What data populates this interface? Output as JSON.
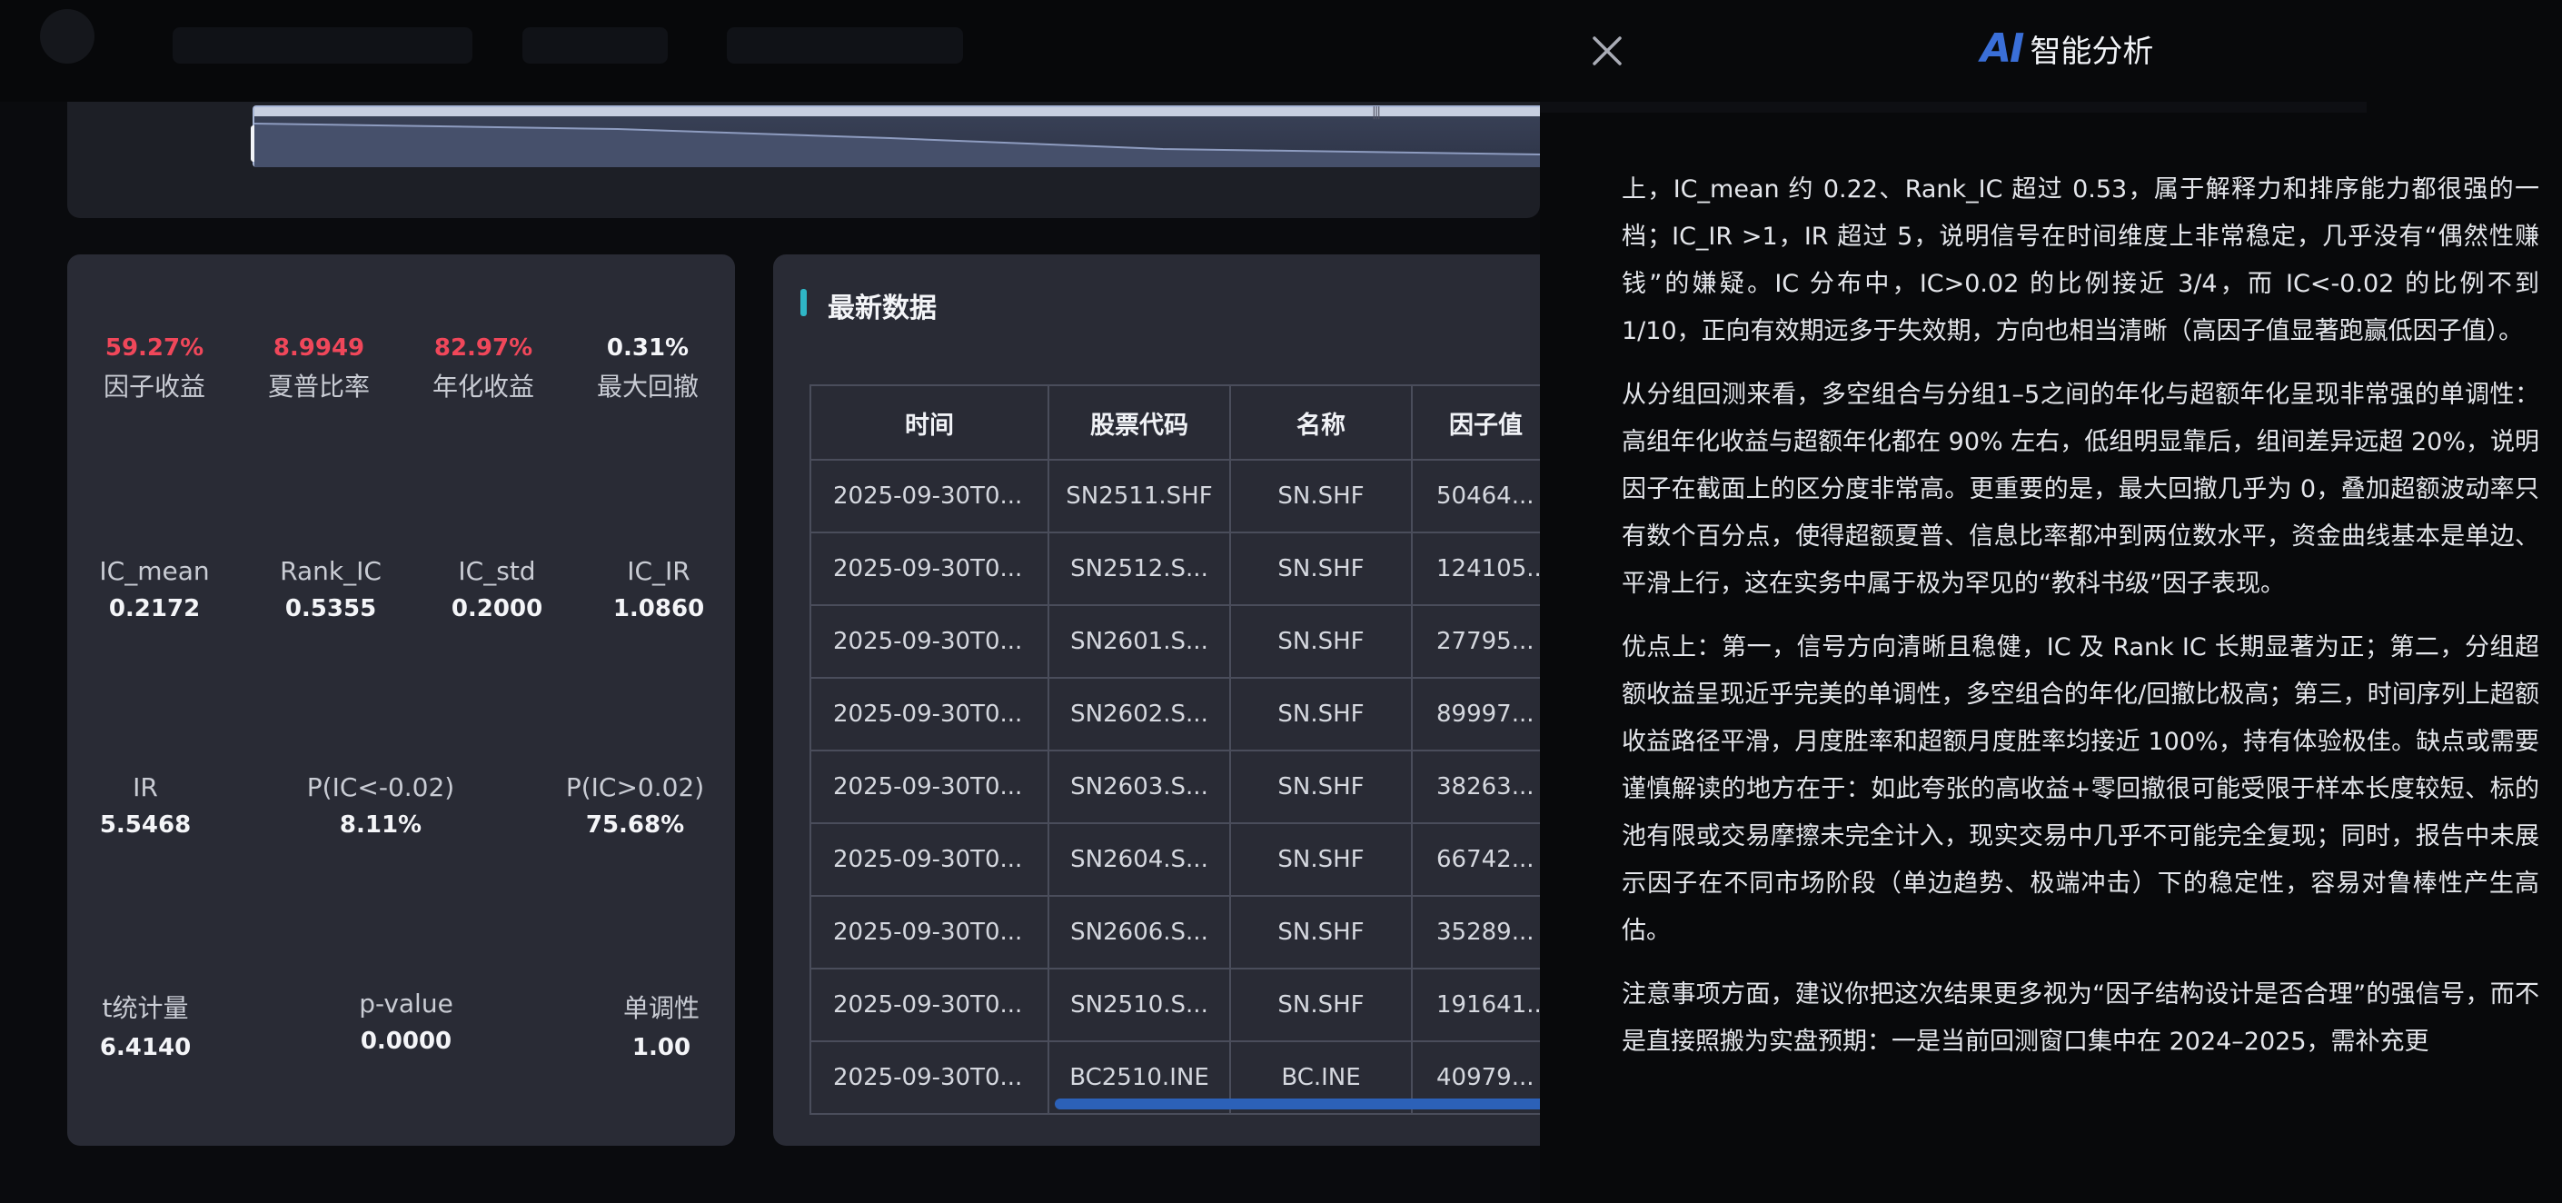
{
  "metrics": {
    "row1": [
      {
        "value": "59.27%",
        "label": "因子收益",
        "accent": "red"
      },
      {
        "value": "8.9949",
        "label": "夏普比率",
        "accent": "red"
      },
      {
        "value": "82.97%",
        "label": "年化收益",
        "accent": "red"
      },
      {
        "value": "0.31%",
        "label": "最大回撤",
        "accent": "none"
      }
    ],
    "row2": [
      {
        "label": "IC_mean",
        "value": "0.2172"
      },
      {
        "label": "Rank_IC",
        "value": "0.5355"
      },
      {
        "label": "IC_std",
        "value": "0.2000"
      },
      {
        "label": "IC_IR",
        "value": "1.0860"
      }
    ],
    "row3": [
      {
        "label": "IR",
        "value": "5.5468"
      },
      {
        "label": "P(IC<-0.02)",
        "value": "8.11%"
      },
      {
        "label": "P(IC>0.02)",
        "value": "75.68%"
      }
    ],
    "row4": [
      {
        "label": "t统计量",
        "value": "6.4140"
      },
      {
        "label": "p-value",
        "value": "0.0000"
      },
      {
        "label": "单调性",
        "value": "1.00"
      }
    ]
  },
  "latest": {
    "title": "最新数据",
    "columns": [
      "时间",
      "股票代码",
      "名称",
      "因子值"
    ],
    "rows": [
      [
        "2025-09-30T0...",
        "SN2511.SHF",
        "SN.SHF",
        "50464..."
      ],
      [
        "2025-09-30T0...",
        "SN2512.S...",
        "SN.SHF",
        "124105..."
      ],
      [
        "2025-09-30T0...",
        "SN2601.S...",
        "SN.SHF",
        "27795..."
      ],
      [
        "2025-09-30T0...",
        "SN2602.S...",
        "SN.SHF",
        "89997..."
      ],
      [
        "2025-09-30T0...",
        "SN2603.S...",
        "SN.SHF",
        "38263..."
      ],
      [
        "2025-09-30T0...",
        "SN2604.S...",
        "SN.SHF",
        "66742..."
      ],
      [
        "2025-09-30T0...",
        "SN2606.S...",
        "SN.SHF",
        "35289..."
      ],
      [
        "2025-09-30T0...",
        "SN2510.S...",
        "SN.SHF",
        "191641..."
      ],
      [
        "2025-09-30T0...",
        "BC2510.INE",
        "BC.INE",
        "40979..."
      ]
    ]
  },
  "modal": {
    "ai_mark": "AI",
    "title": "智能分析",
    "paragraphs": [
      "上，IC_mean 约 0.22、Rank_IC 超过 0.53，属于解释力和排序能力都很强的一档；IC_IR >1，IR 超过 5，说明信号在时间维度上非常稳定，几乎没有“偶然性赚钱”的嫌疑。IC 分布中，IC>0.02 的比例接近 3/4，而 IC<-0.02 的比例不到 1/10，正向有效期远多于失效期，方向也相当清晰（高因子值显著跑赢低因子值）。",
      "从分组回测来看，多空组合与分组1–5之间的年化与超额年化呈现非常强的单调性：高组年化收益与超额年化都在 90% 左右，低组明显靠后，组间差异远超 20%，说明因子在截面上的区分度非常高。更重要的是，最大回撤几乎为 0，叠加超额波动率只有数个百分点，使得超额夏普、信息比率都冲到两位数水平，资金曲线基本是单边、平滑上行，这在实务中属于极为罕见的“教科书级”因子表现。",
      "优点上：第一，信号方向清晰且稳健，IC 及 Rank IC 长期显著为正；第二，分组超额收益呈现近乎完美的单调性，多空组合的年化/回撤比极高；第三，时间序列上超额收益路径平滑，月度胜率和超额月度胜率均接近 100%，持有体验极佳。缺点或需要谨慎解读的地方在于：如此夸张的高收益+零回撤很可能受限于样本长度较短、标的池有限或交易摩擦未完全计入，现实交易中几乎不可能完全复现；同时，报告中未展示因子在不同市场阶段（单边趋势、极端冲击）下的稳定性，容易对鲁棒性产生高估。",
      "注意事项方面，建议你把这次结果更多视为“因子结构设计是否合理”的强信号，而不是直接照搬为实盘预期：一是当前回测窗口集中在 2024–2025，需补充更"
    ]
  },
  "colors": {
    "accent_red": "#f0475a",
    "accent_blue": "#3a6fd8",
    "accent_teal": "#2fb6c6"
  }
}
